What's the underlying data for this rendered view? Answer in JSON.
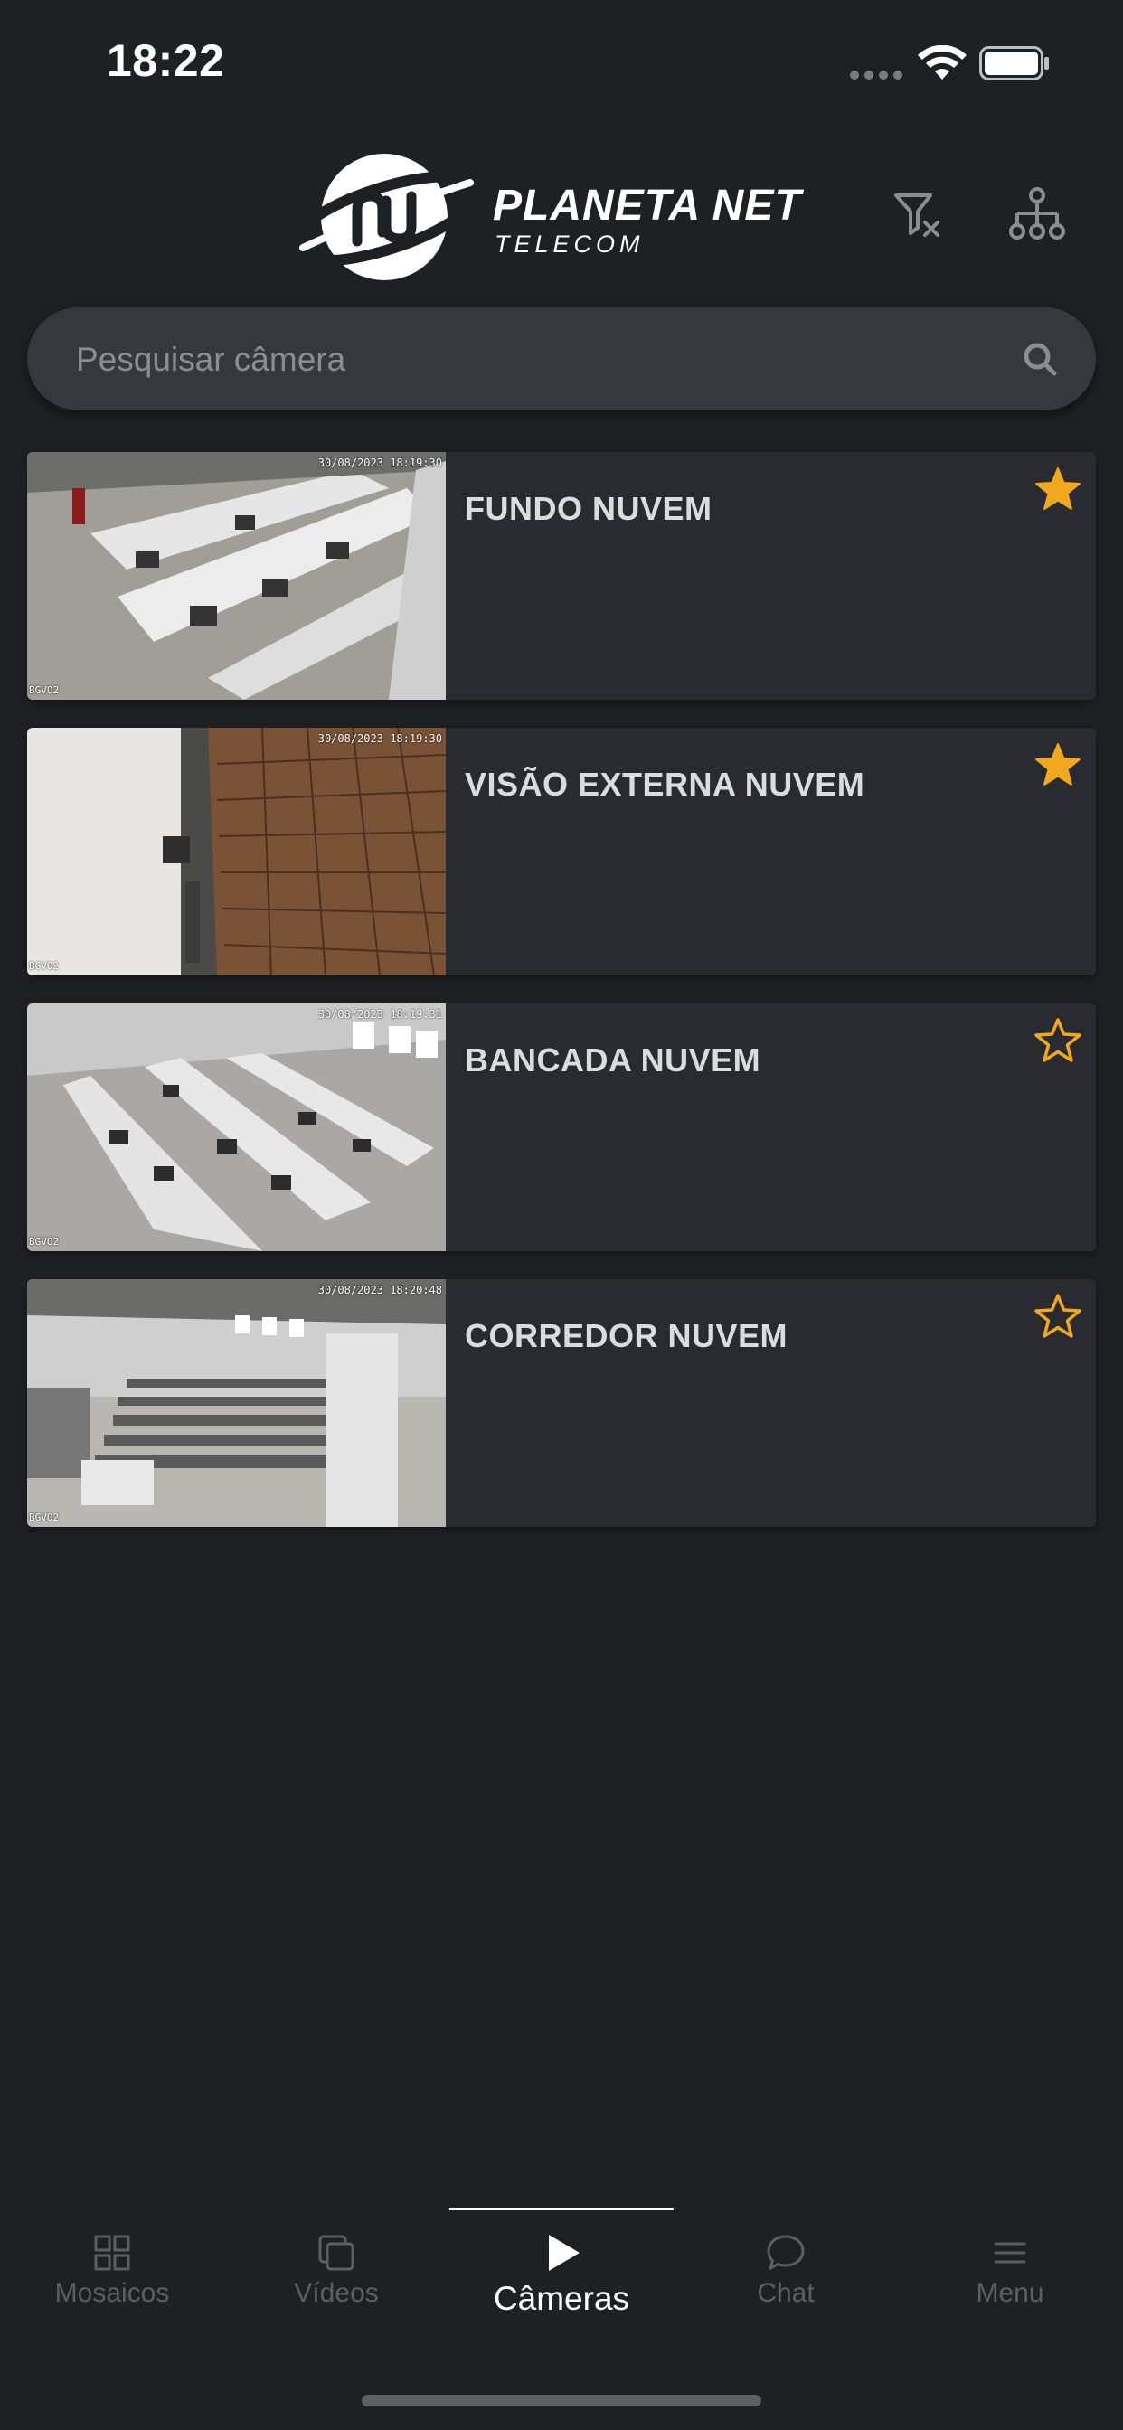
{
  "status_bar": {
    "time": "18:22"
  },
  "header": {
    "brand_name": "PLANETA NET",
    "brand_sub": "TELECOM"
  },
  "search": {
    "placeholder": "Pesquisar câmera"
  },
  "cameras": [
    {
      "name": "FUNDO NUVEM",
      "favorite": true,
      "timestamp": "30/08/2023 18:19:30",
      "tag": "BGVO2"
    },
    {
      "name": "VISÃO EXTERNA NUVEM",
      "favorite": true,
      "timestamp": "30/08/2023 18:19:30",
      "tag": "BGVO2"
    },
    {
      "name": "BANCADA NUVEM",
      "favorite": false,
      "timestamp": "30/08/2023 18:19:31",
      "tag": "BGVO2"
    },
    {
      "name": "CORREDOR NUVEM",
      "favorite": false,
      "timestamp": "30/08/2023 18:20:48",
      "tag": "BGVO2"
    }
  ],
  "tabs": [
    {
      "label": "Mosaicos",
      "icon": "grid-icon"
    },
    {
      "label": "Vídeos",
      "icon": "videos-icon"
    },
    {
      "label": "Câmeras",
      "icon": "play-icon",
      "active": true
    },
    {
      "label": "Chat",
      "icon": "chat-icon"
    },
    {
      "label": "Menu",
      "icon": "menu-icon"
    }
  ],
  "colors": {
    "background": "#1f2024",
    "card": "#2a2b30",
    "star": "#f0a81e",
    "inactive_tab": "#5d5e64"
  }
}
